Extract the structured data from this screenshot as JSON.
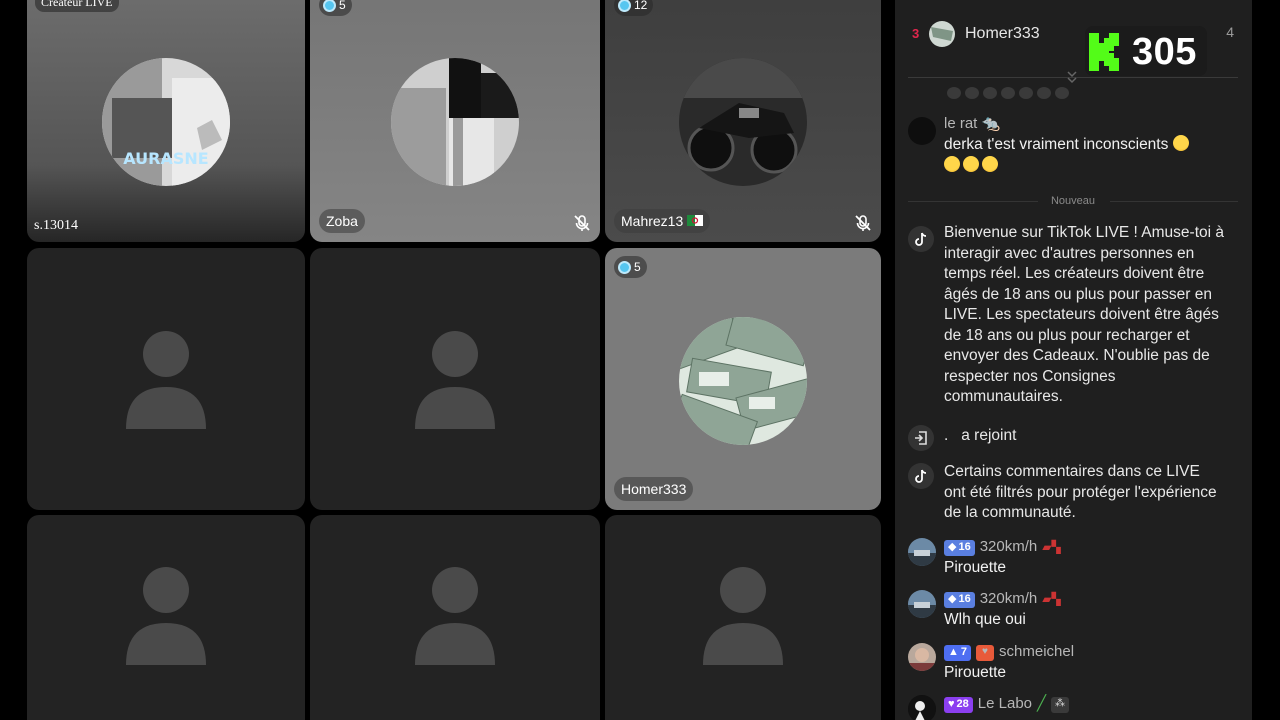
{
  "grid": {
    "tiles": [
      {
        "name": "s.13014",
        "tag": "Créateur LIVE",
        "avatar_text": "AURASNE"
      },
      {
        "name": "Zoba",
        "count": "5"
      },
      {
        "name": "Mahrez13",
        "count": "12"
      },
      {
        "name": ""
      },
      {
        "name": ""
      },
      {
        "name": "Homer333",
        "count": "5"
      },
      {
        "name": ""
      },
      {
        "name": ""
      },
      {
        "name": ""
      }
    ]
  },
  "chat": {
    "top_rank": {
      "rank": "3",
      "name": "Homer333",
      "score": "4"
    },
    "kick_overlay": {
      "count": "305",
      "brand_color": "#53fc18"
    },
    "messages": [
      {
        "user": "le rat 🐀",
        "text": "derka t'est vraiment inconscients"
      },
      {
        "divider": "Nouveau"
      },
      {
        "text": "Bienvenue sur TikTok LIVE ! Amuse-toi à interagir avec d'autres personnes en temps réel. Les créateurs doivent être âgés de 18 ans ou plus pour passer en LIVE. Les spectateurs doivent être âgés de 18 ans ou plus pour recharger et envoyer des Cadeaux. N'oublie pas de respecter nos Consignes communautaires."
      },
      {
        "user": ".",
        "text": "a rejoint"
      },
      {
        "text": "Certains commentaires dans ce LIVE ont été filtrés pour protéger l'expérience de la communauté."
      },
      {
        "level": "16",
        "user": "320km/h",
        "text": "Pirouette"
      },
      {
        "level": "16",
        "user": "320km/h",
        "text": "Wlh que oui"
      },
      {
        "level": "7",
        "user": "schmeichel",
        "text": "Pirouette"
      },
      {
        "level": "28",
        "user": "Le Labo"
      }
    ]
  },
  "colors": {
    "accent_rank": "#e2264d",
    "level_badge": "#4e6ef2",
    "level_badge_purple": "#8b3ff0"
  }
}
